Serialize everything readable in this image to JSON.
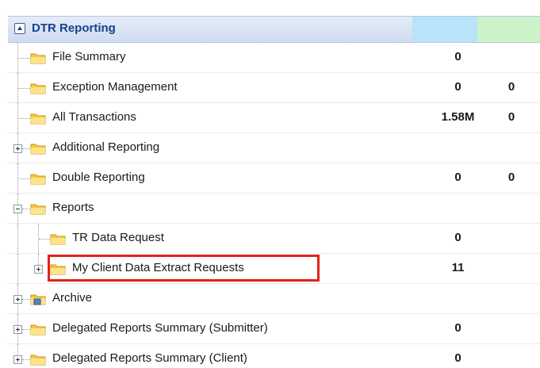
{
  "header": {
    "title": "DTR Reporting"
  },
  "rows": [
    {
      "label": "File Summary",
      "v1": "0",
      "v2": ""
    },
    {
      "label": "Exception Management",
      "v1": "0",
      "v2": "0"
    },
    {
      "label": "All Transactions",
      "v1": "1.58M",
      "v2": "0"
    },
    {
      "label": "Additional Reporting",
      "v1": "",
      "v2": ""
    },
    {
      "label": "Double Reporting",
      "v1": "0",
      "v2": "0"
    },
    {
      "label": "Reports",
      "v1": "",
      "v2": ""
    },
    {
      "label": "TR Data Request",
      "v1": "0",
      "v2": ""
    },
    {
      "label": "My Client Data Extract Requests",
      "v1": "11",
      "v2": ""
    },
    {
      "label": "Archive",
      "v1": "",
      "v2": ""
    },
    {
      "label": "Delegated Reports Summary (Submitter)",
      "v1": "0",
      "v2": ""
    },
    {
      "label": "Delegated Reports Summary (Client)",
      "v1": "0",
      "v2": ""
    }
  ],
  "colors": {
    "header_title": "#15428b",
    "highlight": "#e2231a",
    "folder": "#f5c842",
    "col_blue": "#b7e3fb",
    "col_green": "#ccf3c8"
  },
  "icons": {
    "folder": "folder-icon",
    "archive": "archive-folder-icon",
    "expand": "plus-expander-icon",
    "collapse": "minus-expander-icon"
  }
}
